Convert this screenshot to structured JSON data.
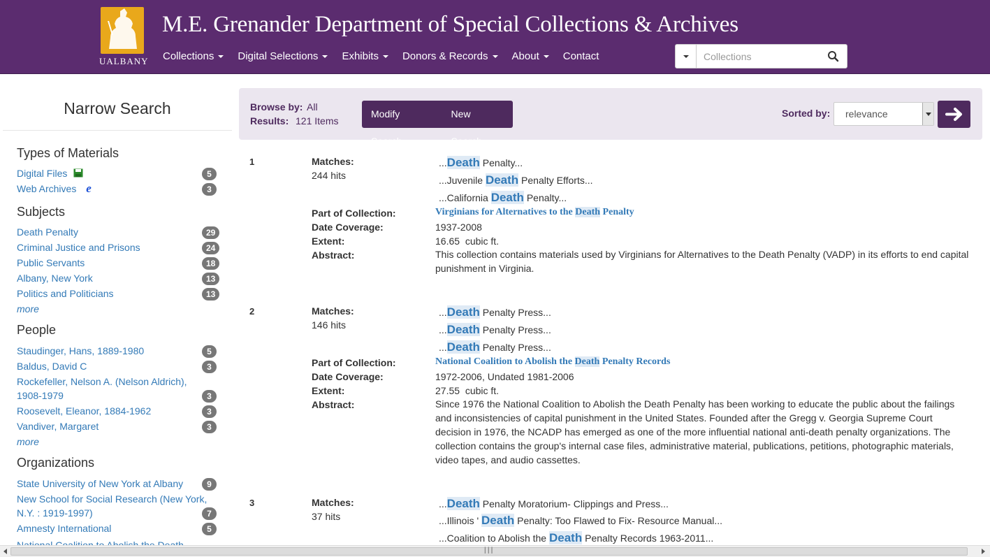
{
  "header": {
    "logo_text": "UALBANY",
    "title": "M.E. Grenander Department of Special Collections & Archives",
    "nav": [
      "Collections",
      "Digital Selections",
      "Exhibits",
      "Donors & Records",
      "About",
      "Contact"
    ],
    "search_placeholder": "Collections"
  },
  "sidebar": {
    "title": "Narrow Search",
    "types_heading": "Types of Materials",
    "types": [
      {
        "label": "Digital Files",
        "count": "5"
      },
      {
        "label": "Web Archives",
        "count": "3"
      }
    ],
    "subjects_heading": "Subjects",
    "subjects": [
      {
        "label": "Death Penalty",
        "count": "29"
      },
      {
        "label": "Criminal Justice and Prisons",
        "count": "24"
      },
      {
        "label": "Public Servants",
        "count": "18"
      },
      {
        "label": "Albany, New York",
        "count": "13"
      },
      {
        "label": "Politics and Politicians",
        "count": "13"
      }
    ],
    "more": "more",
    "people_heading": "People",
    "people": [
      {
        "label": "Staudinger, Hans, 1889-1980",
        "count": "5"
      },
      {
        "label": "Baldus, David C",
        "count": "3"
      },
      {
        "label_line1": "Rockefeller, Nelson A. (Nelson Aldrich),",
        "label_line2": "1908-1979",
        "count": "3"
      },
      {
        "label": "Roosevelt, Eleanor, 1884-1962",
        "count": "3"
      },
      {
        "label": "Vandiver, Margaret",
        "count": "3"
      }
    ],
    "orgs_heading": "Organizations",
    "orgs": [
      {
        "label": "State University of New York at Albany",
        "count": "9"
      },
      {
        "label_line1": "New School for Social Research (New York,",
        "label_line2": "N.Y. : 1919-1997)",
        "count": "7"
      },
      {
        "label": "Amnesty International",
        "count": "5"
      },
      {
        "label": "National Coalition to Abolish the Death",
        "count": ""
      }
    ]
  },
  "results_bar": {
    "browse_label": "Browse by:",
    "browse_value": "All",
    "results_label": "Results:",
    "results_value": "121 Items",
    "modify": "Modify Search",
    "new": "New Search",
    "sorted_label": "Sorted by:",
    "sorted_value": "relevance"
  },
  "labels": {
    "matches": "Matches:",
    "part_of": "Part of Collection:",
    "date_coverage": "Date Coverage:",
    "extent": "Extent:",
    "abstract": "Abstract:"
  },
  "results": [
    {
      "num": "1",
      "hits": "244 hits",
      "snippets": [
        {
          "pre": "...",
          "hit": "Death",
          "post": " Penalty..."
        },
        {
          "pre": "...Juvenile ",
          "hit": "Death",
          "post": " Penalty Efforts..."
        },
        {
          "pre": "...California ",
          "hit": "Death",
          "post": " Penalty..."
        }
      ],
      "collection_pre": "Virginians for Alternatives to the ",
      "collection_hl": "Death",
      "collection_post": " Penalty",
      "date": "1937-2008",
      "extent": "16.65  cubic ft.",
      "abstract": "This collection contains materials used by Virginians for Alternatives to the Death Penalty (VADP) in its efforts to end capital punishment in Virginia."
    },
    {
      "num": "2",
      "hits": "146 hits",
      "snippets": [
        {
          "pre": "...",
          "hit": "Death",
          "post": " Penalty Press..."
        },
        {
          "pre": "...",
          "hit": "Death",
          "post": " Penalty Press..."
        },
        {
          "pre": "...",
          "hit": "Death",
          "post": " Penalty Press..."
        }
      ],
      "collection_pre": "National Coalition to Abolish the ",
      "collection_hl": "Death",
      "collection_post": " Penalty Records",
      "date": "1972-2006, Undated 1981-2006",
      "extent": "27.55  cubic ft.",
      "abstract": "Since 1976 the National Coalition to Abolish the Death Penalty has been working to educate the public about the failings and inconsistencies of capital punishment in the United States. Founded after the Gregg v. Georgia Supreme Court decision in 1976, the NCADP has emerged as one of the more influential national anti-death penalty organizations. The collection contains the group's internal case files, administrative material, publications, petitions, photographic materials, video tapes, and audio cassettes."
    },
    {
      "num": "3",
      "hits": "37 hits",
      "snippets": [
        {
          "pre": "...",
          "hit": "Death",
          "post": " Penalty Moratorium- Clippings and Press..."
        },
        {
          "pre": "...Illinois ' ",
          "hit": "Death",
          "post": " Penalty: Too Flawed to Fix- Resource Manual..."
        },
        {
          "pre": "...Coalition to Abolish the ",
          "hit": "Death",
          "post": " Penalty Records 1963-2011..."
        }
      ]
    }
  ],
  "colors": {
    "brand_purple": "#5b2c6f",
    "button_purple": "#4e2a5e",
    "link_blue": "#337ab7",
    "logo_gold": "#e9a81b"
  }
}
